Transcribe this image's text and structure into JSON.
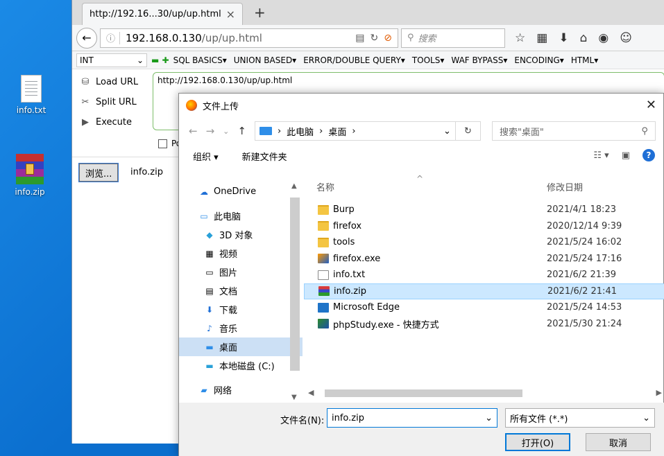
{
  "desktop": {
    "icons": [
      {
        "label": "info.txt"
      },
      {
        "label": "info.zip"
      }
    ]
  },
  "browser": {
    "tab_title": "http://192.16...30/up/up.html",
    "tab_close": "×",
    "new_tab": "+",
    "url_host": "192.168.0.130",
    "url_path": "/up/up.html",
    "search_placeholder": "搜索"
  },
  "hackbar": {
    "select_value": "INT",
    "menus": [
      "SQL BASICS▾",
      "UNION BASED▾",
      "ERROR/DOUBLE QUERY▾",
      "TOOLS▾",
      "WAF BYPASS▾",
      "ENCODING▾",
      "HTML▾"
    ],
    "actions": [
      "Load URL",
      "Split URL",
      "Execute"
    ],
    "text": "http://192.168.0.130/up/up.html",
    "post_label": "Po"
  },
  "page": {
    "browse_label": "浏览...",
    "file_name": "info.zip"
  },
  "dialog": {
    "title": "文件上传",
    "breadcrumb": [
      "此电脑",
      "桌面"
    ],
    "search_placeholder": "搜索\"桌面\"",
    "toolbar": {
      "organize": "组织 ▾",
      "new_folder": "新建文件夹",
      "help": "?"
    },
    "nav_items": [
      {
        "label": "OneDrive"
      },
      {
        "label": "此电脑"
      },
      {
        "label": "3D 对象"
      },
      {
        "label": "视频"
      },
      {
        "label": "图片"
      },
      {
        "label": "文档"
      },
      {
        "label": "下载"
      },
      {
        "label": "音乐"
      },
      {
        "label": "桌面"
      },
      {
        "label": "本地磁盘 (C:)"
      },
      {
        "label": "网络"
      }
    ],
    "columns": {
      "name": "名称",
      "date": "修改日期"
    },
    "files": [
      {
        "name": "Burp",
        "date": "2021/4/1 18:23",
        "type": "folder"
      },
      {
        "name": "firefox",
        "date": "2020/12/14 9:39",
        "type": "folder"
      },
      {
        "name": "tools",
        "date": "2021/5/24 16:02",
        "type": "folder"
      },
      {
        "name": "firefox.exe",
        "date": "2021/5/24 17:16",
        "type": "exe"
      },
      {
        "name": "info.txt",
        "date": "2021/6/2 21:39",
        "type": "txt"
      },
      {
        "name": "info.zip",
        "date": "2021/6/2 21:41",
        "type": "zip"
      },
      {
        "name": "Microsoft Edge",
        "date": "2021/5/24 14:53",
        "type": "edge"
      },
      {
        "name": "phpStudy.exe - 快捷方式",
        "date": "2021/5/30 21:24",
        "type": "php"
      }
    ],
    "filename_label": "文件名(N):",
    "filename_value": "info.zip",
    "filetype_value": "所有文件 (*.*)",
    "open_button": "打开(O)",
    "cancel_button": "取消"
  }
}
